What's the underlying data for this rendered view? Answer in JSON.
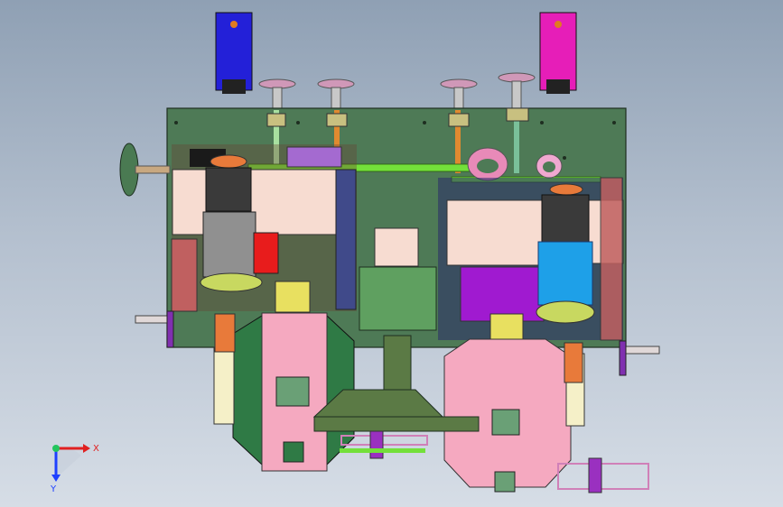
{
  "triad": {
    "x_label": "X",
    "y_label": "Y",
    "colors": {
      "x": "#e02020",
      "y": "#1e40ff",
      "z": "#22c55e"
    }
  },
  "colors": {
    "frame": "#4e7a56",
    "panel": "#f7dcd1",
    "pink_housing": "#f5a9c0",
    "green_housing": "#2f7a45",
    "purple": "#a01ad0",
    "motor_dark": "#3a3a3a",
    "motor_blue": "#1ea0e8",
    "olive_yoke": "#5b7a45",
    "blue_box": "#2320d8",
    "magenta_box": "#e61eb8",
    "shaft_green": "#73e03a"
  }
}
